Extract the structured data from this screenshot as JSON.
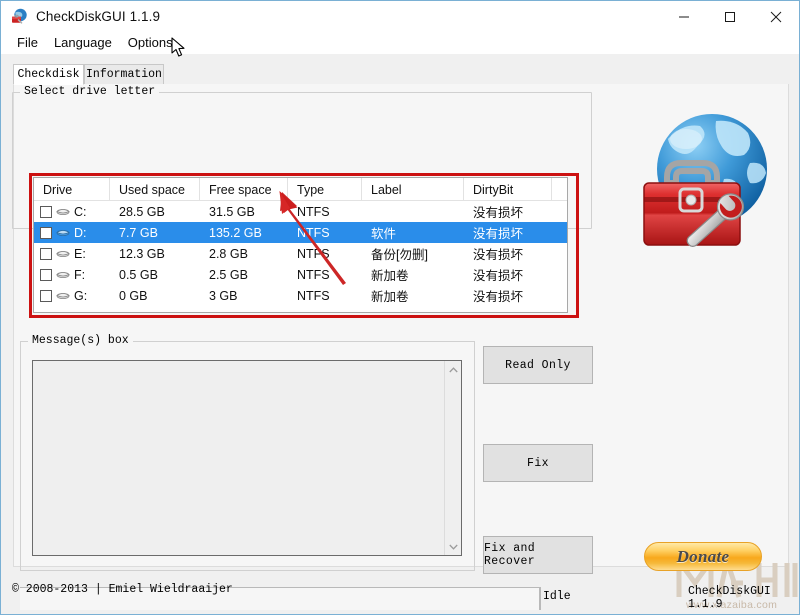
{
  "window": {
    "title": "CheckDiskGUI 1.1.9",
    "icon": "globe-toolbox-icon",
    "minimize_label": "—",
    "maximize_label": "☐",
    "close_label": "✕"
  },
  "menubar": {
    "items": [
      {
        "label": "File"
      },
      {
        "label": "Language"
      },
      {
        "label": "Options"
      }
    ]
  },
  "tabs": [
    {
      "label": "Checkdisk",
      "active": true
    },
    {
      "label": "Information",
      "active": false
    }
  ],
  "drive_group": {
    "legend": "Select drive letter",
    "columns": [
      "Drive",
      "Used space",
      "Free space",
      "Type",
      "Label",
      "DirtyBit"
    ],
    "rows": [
      {
        "drive": "C:",
        "used": "28.5 GB",
        "free": "31.5 GB",
        "type": "NTFS",
        "label": "",
        "dirtybit": "没有损坏",
        "selected": false,
        "checked": false
      },
      {
        "drive": "D:",
        "used": "7.7 GB",
        "free": "135.2 GB",
        "type": "NTFS",
        "label": "软件",
        "dirtybit": "没有损坏",
        "selected": true,
        "checked": false
      },
      {
        "drive": "E:",
        "used": "12.3 GB",
        "free": "2.8 GB",
        "type": "NTFS",
        "label": "备份[勿删]",
        "dirtybit": "没有损坏",
        "selected": false,
        "checked": false
      },
      {
        "drive": "F:",
        "used": "0.5 GB",
        "free": "2.5 GB",
        "type": "NTFS",
        "label": "新加卷",
        "dirtybit": "没有损坏",
        "selected": false,
        "checked": false
      },
      {
        "drive": "G:",
        "used": "0 GB",
        "free": "3 GB",
        "type": "NTFS",
        "label": "新加卷",
        "dirtybit": "没有损坏",
        "selected": false,
        "checked": false
      }
    ]
  },
  "message_group": {
    "legend": "Message(s) box",
    "text": "",
    "placeholder": ""
  },
  "actions": {
    "read_only": "Read Only",
    "fix": "Fix",
    "fix_and_recover": "Fix and Recover"
  },
  "status": {
    "progress_text": "",
    "state": "Idle"
  },
  "footer": {
    "copyright": "© 2008-2013 | Emiel Wieldraaijer",
    "app_version": "CheckDiskGUI 1.1.9"
  },
  "donate": {
    "label": "Donate"
  },
  "watermark": {
    "url": "www.xiazaiba.com"
  },
  "colors": {
    "selection_blue": "#2a8dea",
    "annotation_red": "#cc1111",
    "window_border": "#7ab0d4",
    "client_bg": "#f0f0f0",
    "donate_orange": "#f8a81c"
  }
}
